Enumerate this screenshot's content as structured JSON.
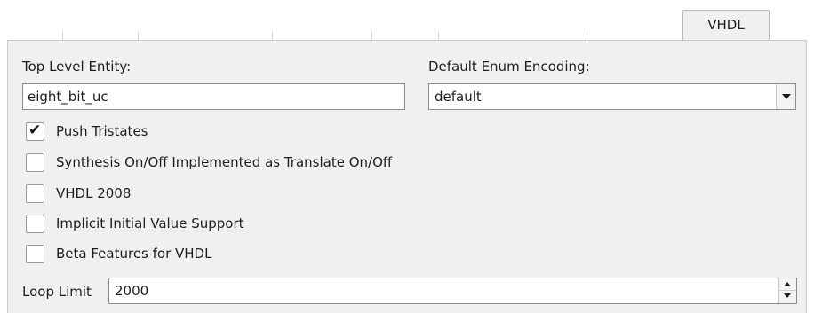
{
  "tabs": {
    "active": "VHDL"
  },
  "form": {
    "top_level_entity_label": "Top Level Entity:",
    "top_level_entity_value": "eight_bit_uc",
    "enum_encoding_label": "Default Enum Encoding:",
    "enum_encoding_value": "default",
    "checkboxes": [
      {
        "label": "Push Tristates",
        "checked": true,
        "mark": "✔"
      },
      {
        "label": "Synthesis On/Off Implemented as Translate On/Off",
        "checked": false,
        "mark": ""
      },
      {
        "label": "VHDL 2008",
        "checked": false,
        "mark": ""
      },
      {
        "label": "Implicit Initial Value Support",
        "checked": false,
        "mark": ""
      },
      {
        "label": "Beta Features for VHDL",
        "checked": false,
        "mark": ""
      }
    ],
    "loop_limit_label": "Loop Limit",
    "loop_limit_value": "2000"
  },
  "icons": {
    "combo_arrow": "chevron-down-icon",
    "spin_up": "spin-up-icon",
    "spin_down": "spin-down-icon",
    "check": "checkmark-icon"
  },
  "colors": {
    "panel_bg": "#f0f0f0",
    "field_border": "#8c8c8c"
  }
}
